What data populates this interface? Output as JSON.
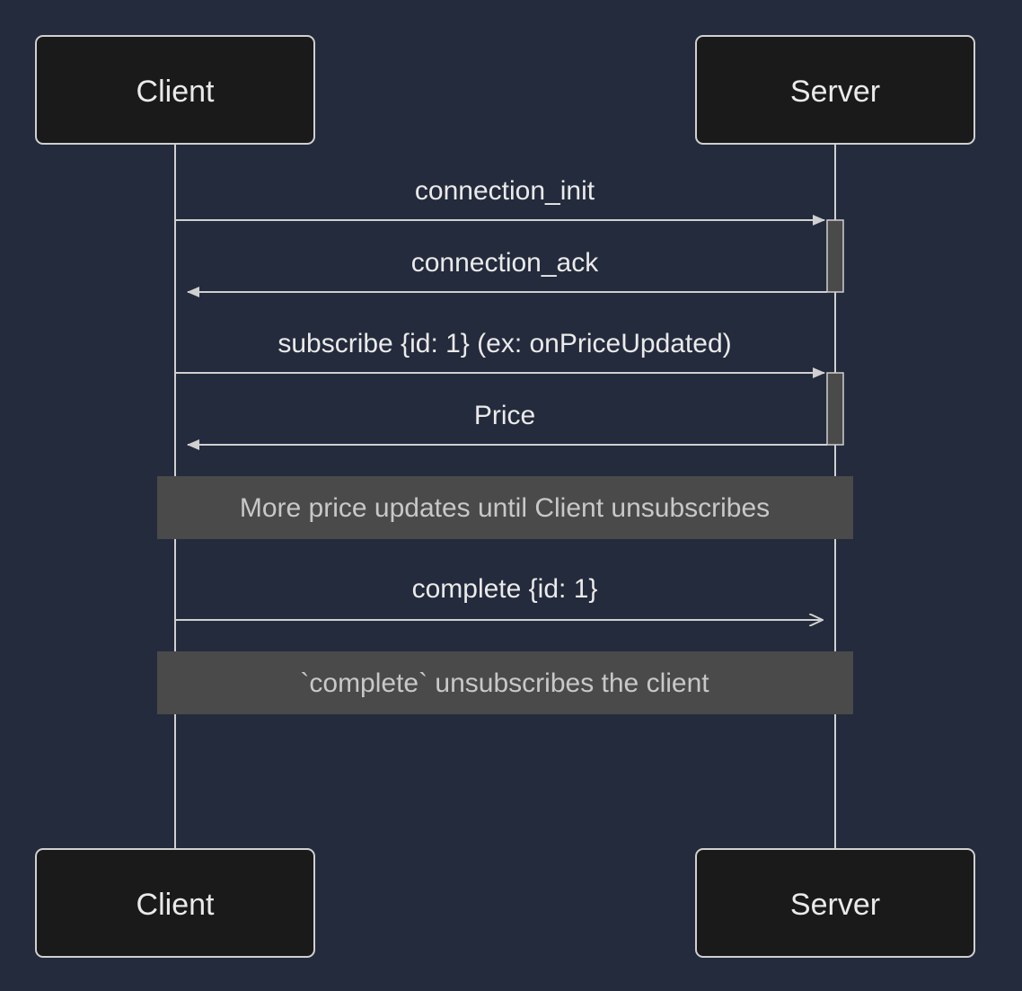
{
  "diagram": {
    "actors": {
      "client": "Client",
      "server": "Server"
    },
    "messages": {
      "m1": "connection_init",
      "m2": "connection_ack",
      "m3": "subscribe {id: 1} (ex: onPriceUpdated)",
      "m4": "Price",
      "m5": "complete {id: 1}"
    },
    "notes": {
      "n1": "More price updates until Client unsubscribes",
      "n2": "`complete` unsubscribes the client"
    }
  }
}
